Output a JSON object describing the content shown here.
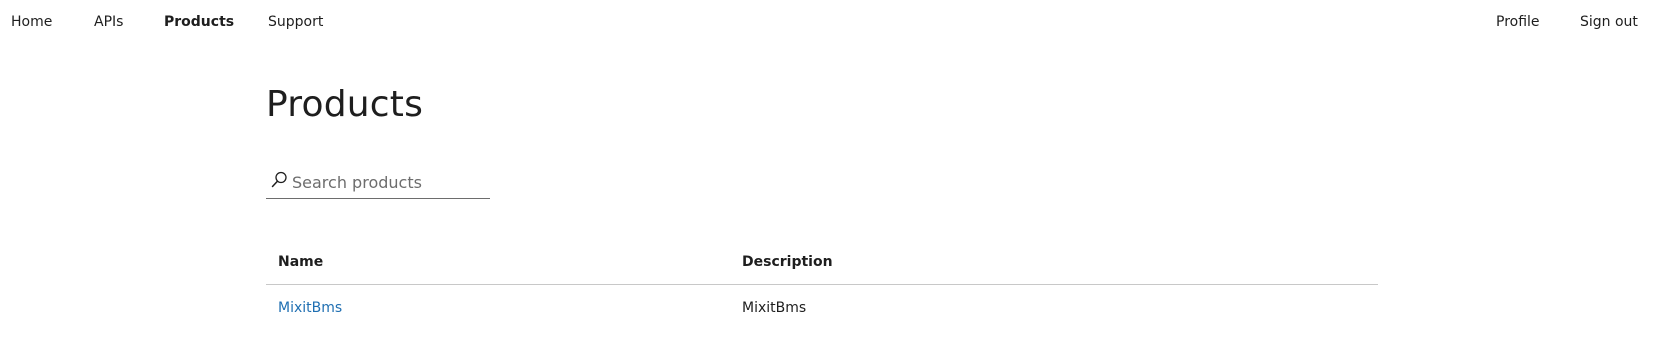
{
  "nav": {
    "left": [
      {
        "label": "Home",
        "active": false
      },
      {
        "label": "APIs",
        "active": false
      },
      {
        "label": "Products",
        "active": true
      },
      {
        "label": "Support",
        "active": false
      }
    ],
    "right": [
      {
        "label": "Profile"
      },
      {
        "label": "Sign out"
      }
    ]
  },
  "page": {
    "title": "Products"
  },
  "search": {
    "placeholder": "Search products",
    "value": "",
    "icon": "search-icon"
  },
  "table": {
    "columns": [
      "Name",
      "Description"
    ],
    "rows": [
      {
        "name": "MixitBms",
        "description": "MixitBms"
      }
    ]
  },
  "colors": {
    "link": "#1f6fb2",
    "text": "#1e1e1e",
    "divider": "#c8c8c8"
  }
}
